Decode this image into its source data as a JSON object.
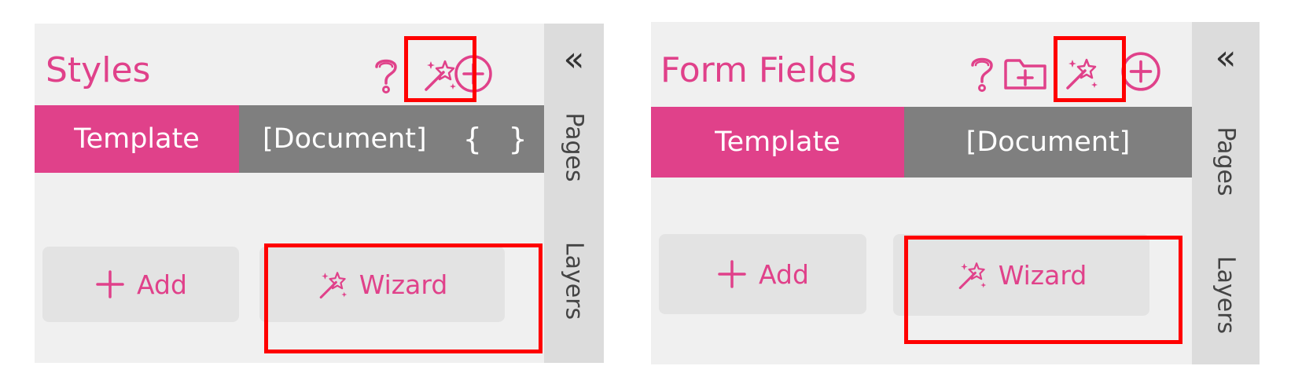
{
  "panels": [
    {
      "title": "Styles",
      "tabs": {
        "template": "Template",
        "document": "[Document]",
        "braces": "{ }"
      },
      "buttons": {
        "add": "Add",
        "wizard": "Wizard"
      },
      "side": {
        "collapse": "«",
        "pages": "Pages",
        "layers": "Layers"
      }
    },
    {
      "title": "Form Fields",
      "tabs": {
        "template": "Template",
        "document": "[Document]"
      },
      "buttons": {
        "add": "Add",
        "wizard": "Wizard"
      },
      "side": {
        "collapse": "«",
        "pages": "Pages",
        "layers": "Layers"
      }
    }
  ],
  "colors": {
    "accent": "#e0418a",
    "tab_inactive": "#7f7f7f",
    "panel_bg": "#f0f0f0",
    "sidebar_bg": "#dcdcdc",
    "button_bg": "#e3e3e3",
    "highlight": "#ff0000"
  },
  "icons": {
    "help": "question-mark-icon",
    "wizard": "magic-wand-icon",
    "add": "plus-circle-icon",
    "new_folder": "folder-plus-icon",
    "plus": "plus-icon"
  }
}
